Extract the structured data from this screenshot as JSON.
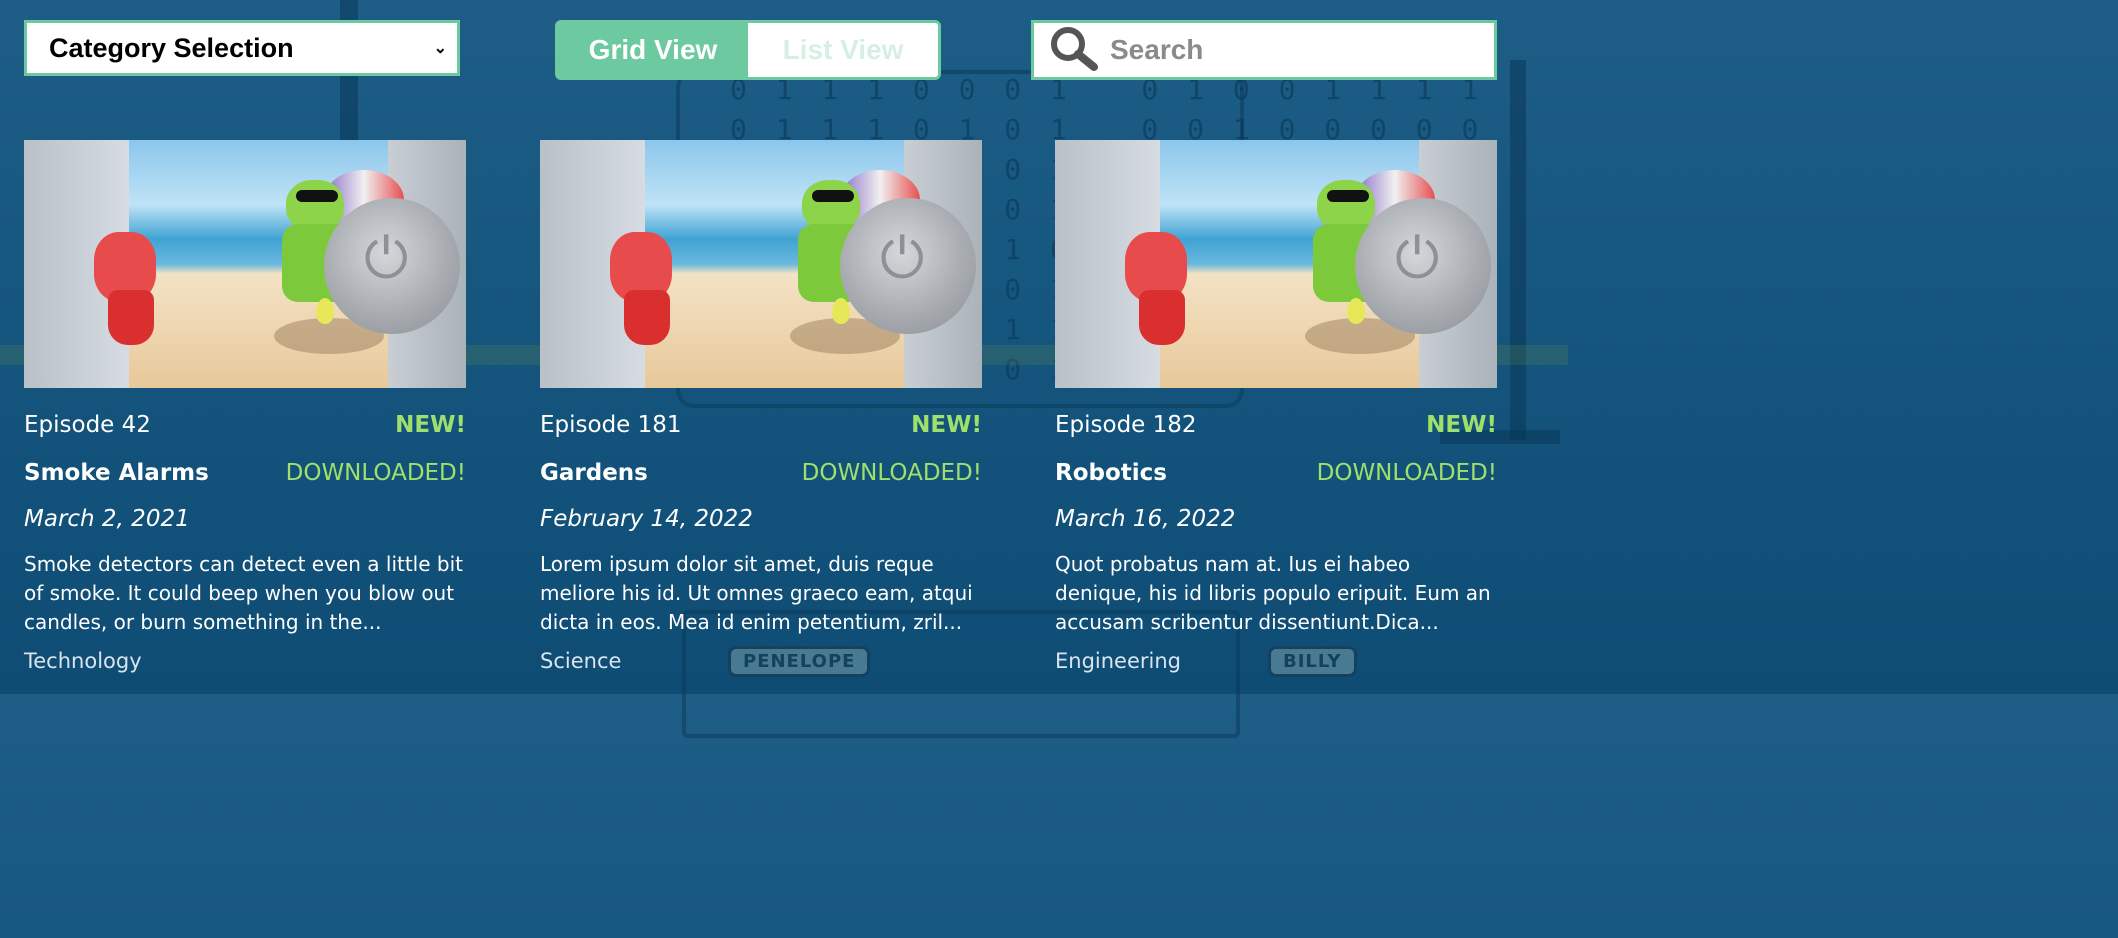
{
  "controls": {
    "category_select": {
      "label": "Category Selection"
    },
    "view_toggle": {
      "grid_label": "Grid View",
      "list_label": "List View",
      "active": "grid"
    },
    "search": {
      "placeholder": "Search",
      "value": ""
    }
  },
  "background_signs": [
    "PENELOPE",
    "BILLY"
  ],
  "episodes": [
    {
      "episode": "Episode 42",
      "badge_new": "NEW!",
      "title": "Smoke Alarms",
      "badge_downloaded": "DOWNLOADED!",
      "date": "March 2, 2021",
      "description": "Smoke detectors can detect even a little bit of smoke. It could beep when you blow out candles, or burn something in the...",
      "category": "Technology"
    },
    {
      "episode": "Episode 181",
      "badge_new": "NEW!",
      "title": "Gardens",
      "badge_downloaded": "DOWNLOADED!",
      "date": "February 14, 2022",
      "description": "Lorem ipsum dolor sit amet, duis reque meliore his id. Ut omnes graeco eam, atqui dicta in eos. Mea id enim petentium, zril...",
      "category": "Science"
    },
    {
      "episode": "Episode 182",
      "badge_new": "NEW!",
      "title": "Robotics",
      "badge_downloaded": "DOWNLOADED!",
      "date": "March 16, 2022",
      "description": "Quot probatus nam at. Ius ei habeo denique, his id libris populo eripuit. Eum an accusam scribentur dissentiunt.Dica...",
      "category": "Engineering"
    }
  ],
  "colors": {
    "accent": "#6cc9a0",
    "badge_green": "#9fe06d",
    "background": "#16577f"
  }
}
